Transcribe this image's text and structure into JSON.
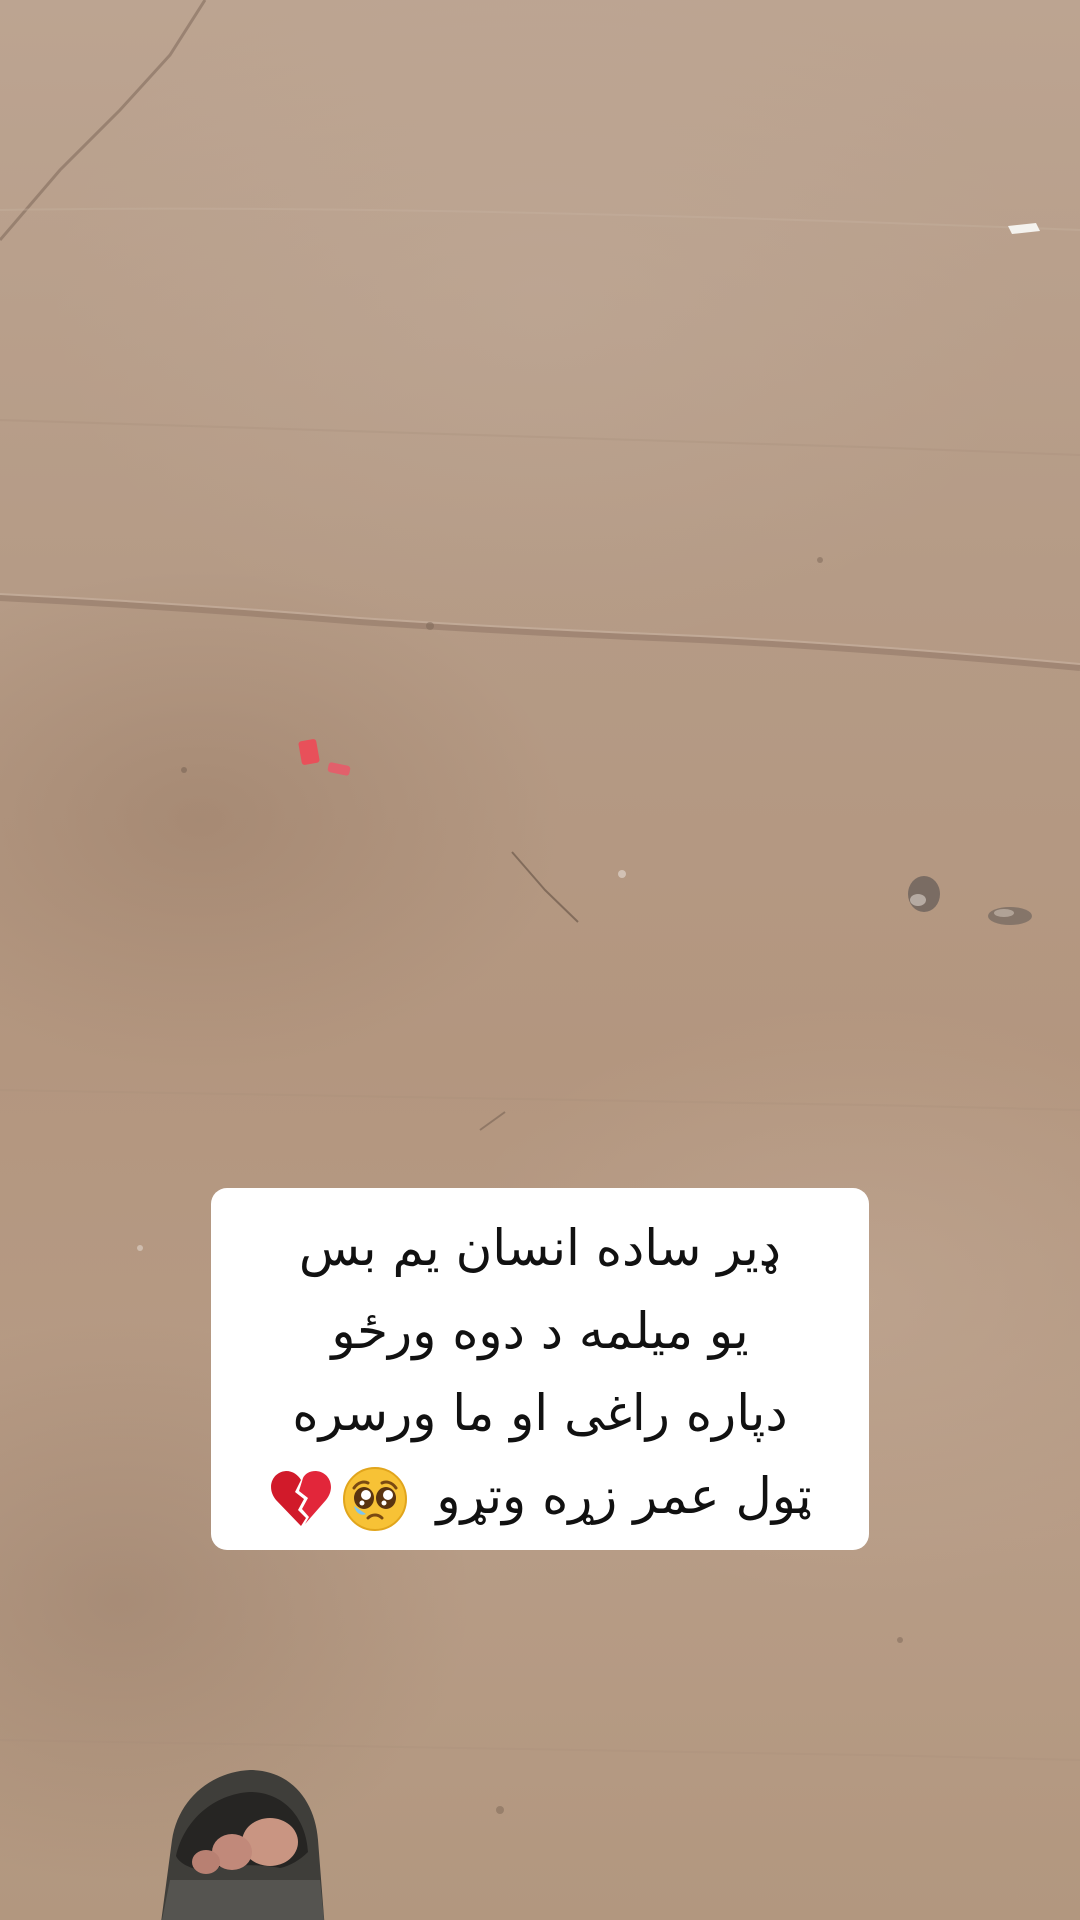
{
  "caption": {
    "lines": [
      "ډیر ساده انسان یم بس",
      "یو میلمه د دوه ورځو",
      "دپاره راغی او ما ورسره",
      "ټول عمر زړه وتړو"
    ],
    "emojis": [
      "pleading-face-icon",
      "broken-heart-icon"
    ]
  },
  "colors": {
    "concrete": "#b89c86",
    "caption_background": "#ffffff",
    "caption_text": "#111111",
    "heart": "#d11a2a"
  }
}
